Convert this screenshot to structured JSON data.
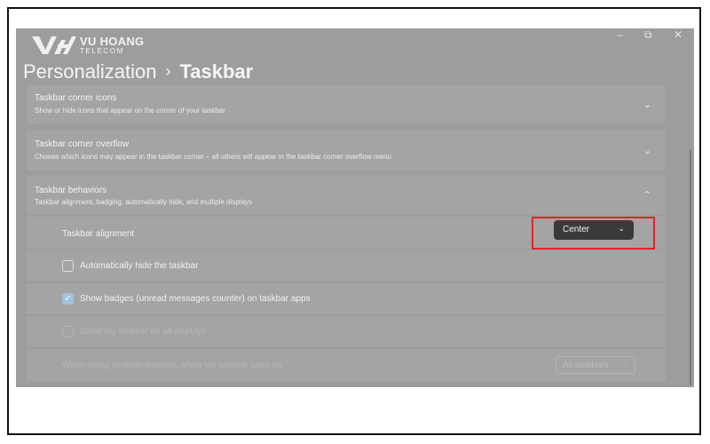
{
  "branding": {
    "name": "VU HOANG",
    "sub": "TELECOM"
  },
  "window_controls": {
    "minimize": "–",
    "maximize": "⧉",
    "close": "✕"
  },
  "breadcrumb": {
    "parent": "Personalization",
    "separator": "›",
    "current": "Taskbar"
  },
  "sections": {
    "corner_icons": {
      "title": "Taskbar corner icons",
      "desc": "Show or hide icons that appear on the corner of your taskbar",
      "chevron": "⌄"
    },
    "corner_overflow": {
      "title": "Taskbar corner overflow",
      "desc": "Choose which icons may appear in the taskbar corner – all others will appear in the taskbar corner overflow menu",
      "chevron": "⌄"
    },
    "behaviors": {
      "title": "Taskbar behaviors",
      "desc": "Taskbar alignment, badging, automatically hide, and multiple displays",
      "chevron": "⌃",
      "alignment_label": "Taskbar alignment",
      "alignment_value": "Center",
      "dropdown_arrow": "⌄",
      "auto_hide_label": "Automatically hide the taskbar",
      "auto_hide_checked": false,
      "badges_label": "Show badges (unread messages counter) on taskbar apps",
      "badges_checked": true,
      "check_glyph": "✓",
      "all_displays_label": "Show my taskbar on all displays",
      "all_displays_enabled": false,
      "multi_display_label": "When using multiple displays, show my taskbar apps on",
      "multi_display_value": "All taskbars"
    }
  },
  "highlight_color": "#e4222c"
}
